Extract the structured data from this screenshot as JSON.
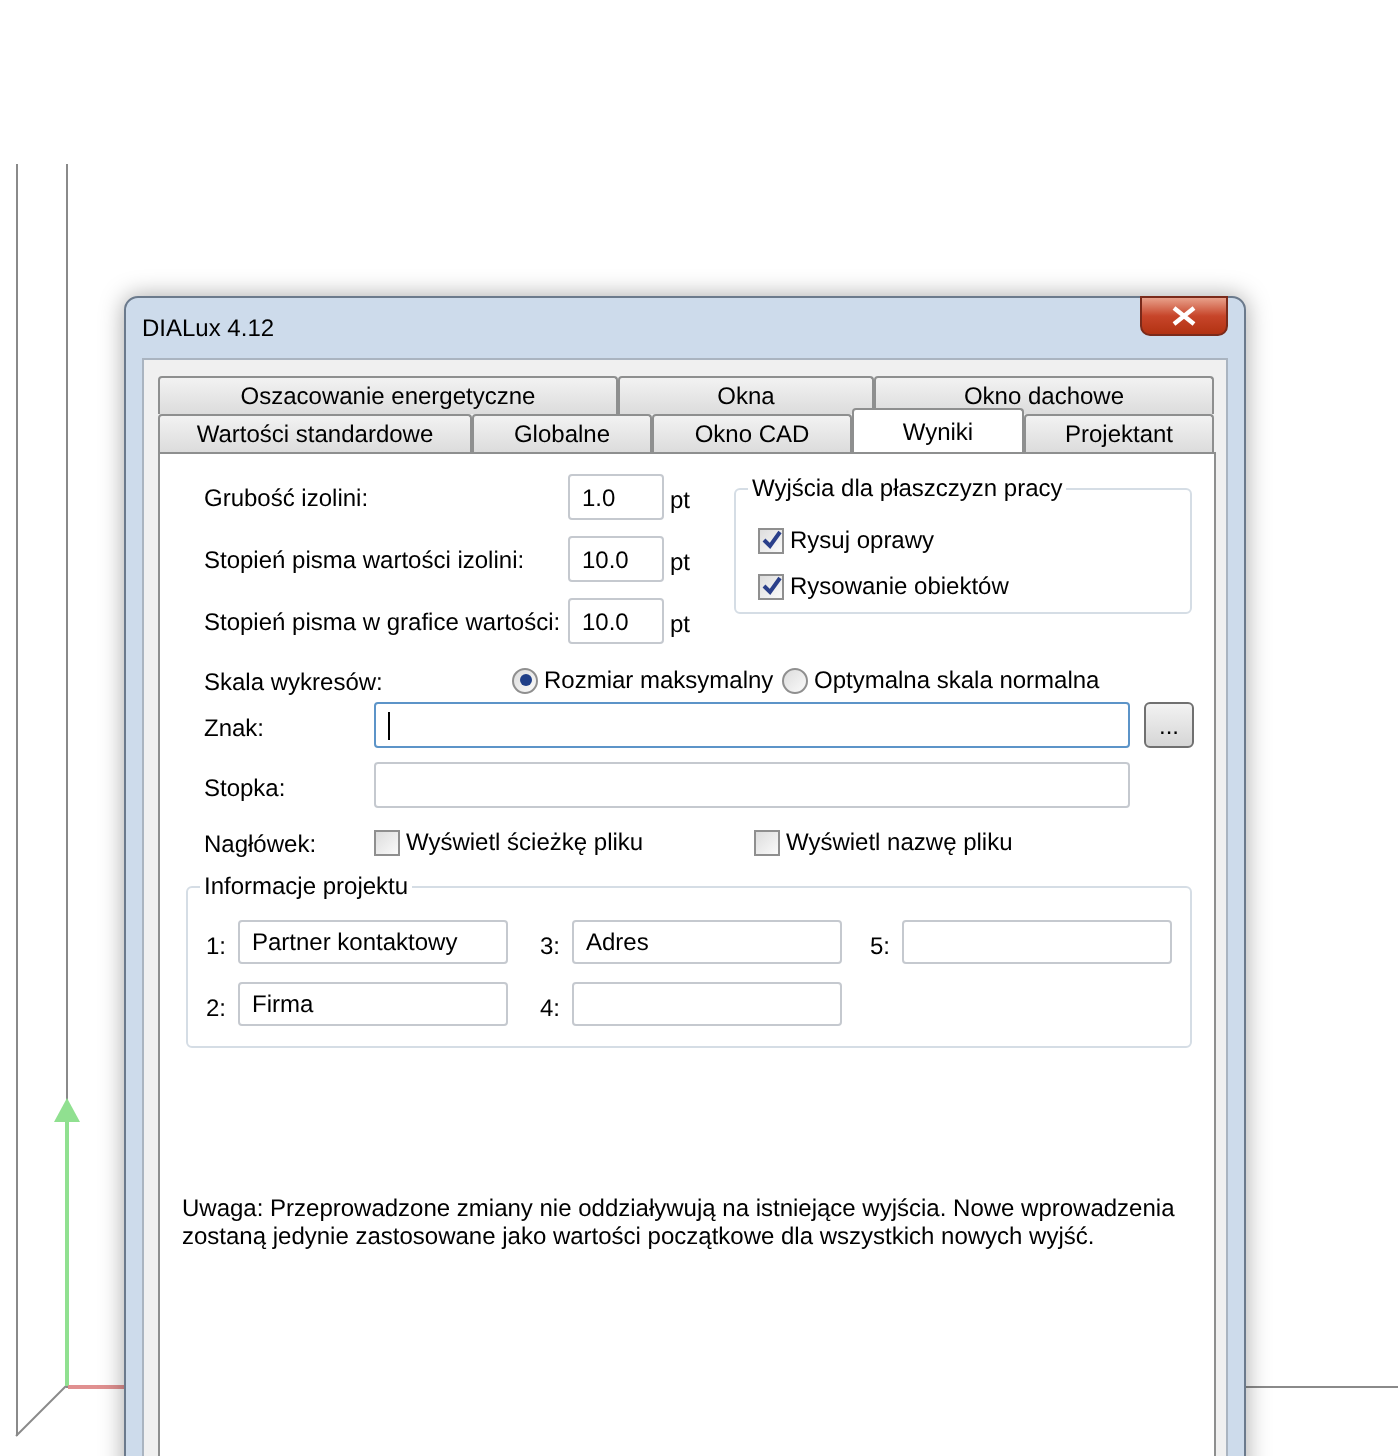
{
  "window": {
    "title": "DIALux 4.12"
  },
  "tab_rows": [
    [
      {
        "label": "Oszacowanie energetyczne",
        "selected": false
      },
      {
        "label": "Okna",
        "selected": false
      },
      {
        "label": "Okno dachowe",
        "selected": false
      }
    ],
    [
      {
        "label": "Wartości standardowe",
        "selected": false
      },
      {
        "label": "Globalne",
        "selected": false
      },
      {
        "label": "Okno CAD",
        "selected": false
      },
      {
        "label": "Wyniki",
        "selected": true
      },
      {
        "label": "Projektant",
        "selected": false
      }
    ]
  ],
  "size_fields": [
    {
      "label": "Grubość izolini:",
      "value": "1.0",
      "unit": "pt"
    },
    {
      "label": "Stopień pisma wartości izolini:",
      "value": "10.0",
      "unit": "pt"
    },
    {
      "label": "Stopień pisma w grafice wartości:",
      "value": "10.0",
      "unit": "pt"
    }
  ],
  "output_group": {
    "title": "Wyjścia dla płaszczyzn pracy",
    "options": [
      {
        "label": "Rysuj oprawy",
        "checked": true
      },
      {
        "label": "Rysowanie obiektów",
        "checked": true
      }
    ]
  },
  "chart_scale": {
    "label": "Skala wykresów:",
    "options": [
      {
        "label": "Rozmiar maksymalny",
        "selected": true
      },
      {
        "label": "Optymalna skala normalna",
        "selected": false
      }
    ]
  },
  "sign": {
    "label": "Znak:",
    "focused": true,
    "browse": "..."
  },
  "footer": {
    "label": "Stopka:"
  },
  "header": {
    "label": "Nagłówek:",
    "options": [
      {
        "label": "Wyświetl ścieżkę pliku",
        "checked": false
      },
      {
        "label": "Wyświetl nazwę pliku",
        "checked": false
      }
    ]
  },
  "project_info": {
    "title": "Informacje projektu",
    "fields": [
      {
        "label": "1:",
        "value": "Partner kontaktowy"
      },
      {
        "label": "2:",
        "value": "Firma"
      },
      {
        "label": "3:",
        "value": "Adres"
      },
      {
        "label": "4:"
      },
      {
        "label": "5:"
      }
    ]
  },
  "note": "Uwaga: Przeprowadzone zmiany nie oddziaływują na istniejące wyjścia. Nowe wprowadzenia zostaną jedynie zastosowane jako wartości początkowe dla wszystkich nowych wyjść."
}
